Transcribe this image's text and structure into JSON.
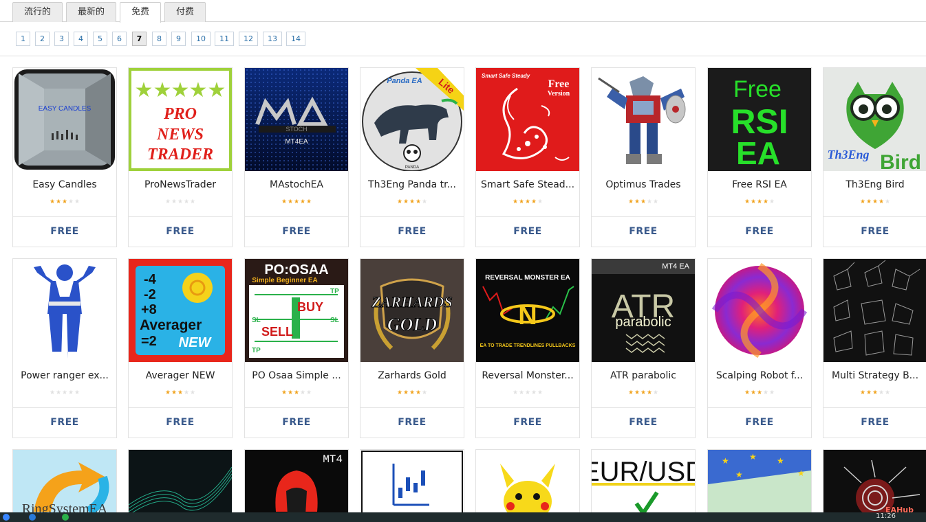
{
  "tabs": [
    "流行的",
    "最新的",
    "免费",
    "付费"
  ],
  "active_tab": 2,
  "pagination": {
    "pages": [
      "1",
      "2",
      "3",
      "4",
      "5",
      "6",
      "7",
      "8",
      "9",
      "10",
      "11",
      "12",
      "13",
      "14"
    ],
    "current": "7"
  },
  "products_row1": [
    {
      "title": "Easy Candles",
      "rating": 3,
      "price": "FREE",
      "thumb": "easy-candles"
    },
    {
      "title": "ProNewsTrader",
      "rating": 0,
      "price": "FREE",
      "thumb": "pro-news-trader"
    },
    {
      "title": "MAstochEA",
      "rating": 5,
      "price": "FREE",
      "thumb": "mastoch"
    },
    {
      "title": "Th3Eng Panda tr...",
      "rating": 4,
      "price": "FREE",
      "thumb": "panda"
    },
    {
      "title": "Smart Safe Stead...",
      "rating": 4,
      "price": "FREE",
      "thumb": "smart-safe"
    },
    {
      "title": "Optimus Trades",
      "rating": 3,
      "price": "FREE",
      "thumb": "optimus"
    },
    {
      "title": "Free RSI EA",
      "rating": 4,
      "price": "FREE",
      "thumb": "rsi"
    },
    {
      "title": "Th3Eng Bird",
      "rating": 4,
      "price": "FREE",
      "thumb": "bird"
    }
  ],
  "products_row2": [
    {
      "title": "Power ranger ex...",
      "rating": 0,
      "price": "FREE",
      "thumb": "ranger"
    },
    {
      "title": "Averager NEW",
      "rating": 3,
      "price": "FREE",
      "thumb": "averager"
    },
    {
      "title": "PO Osaa Simple ...",
      "rating": 3,
      "price": "FREE",
      "thumb": "poosaa"
    },
    {
      "title": "Zarhards Gold",
      "rating": 4,
      "price": "FREE",
      "thumb": "zarhards"
    },
    {
      "title": "Reversal Monster...",
      "rating": 0,
      "price": "FREE",
      "thumb": "reversal"
    },
    {
      "title": "ATR parabolic",
      "rating": 4,
      "price": "FREE",
      "thumb": "atr"
    },
    {
      "title": "Scalping Robot f...",
      "rating": 3,
      "price": "FREE",
      "thumb": "scalping"
    },
    {
      "title": "Multi Strategy B...",
      "rating": 3,
      "price": "FREE",
      "thumb": "multi"
    }
  ],
  "row3_labels": {
    "ring": "RingSystemEA",
    "mt4": "MT4",
    "eurusd": "EUR/USD"
  },
  "thumb_text": {
    "easy_candles": "EASY CANDLES",
    "pro_news": [
      "PRO",
      "NEWS",
      "TRADER"
    ],
    "mastoch_sub": "MT4EA",
    "panda_brand": "Panda EA",
    "lite": "Lite",
    "panda_small": "PANDA",
    "smart_safe_top": "Smart Safe Steady",
    "smart_safe_free": "Free",
    "smart_safe_version": "Version",
    "rsi": [
      "Free",
      "RSI",
      "EA"
    ],
    "bird": [
      "Th3Eng",
      "Bird"
    ],
    "averager": [
      "-4",
      "-2",
      "+8",
      "Averager",
      "=2",
      "NEW"
    ],
    "poosaa_title": "PO:OSAA",
    "poosaa_sub": "Simple Beginner EA",
    "poosaa_buy": "BUY",
    "poosaa_sell": "SELL",
    "tp": "TP",
    "sl": "SL",
    "zarhards": [
      "ZARHARDS",
      "GOLD"
    ],
    "reversal_title": "REVERSAL MONSTER EA",
    "reversal_arc": "EA TO TRADE TRENDLINES PULLBACKS",
    "atr": [
      "MT4 EA",
      "ATR",
      "parabolic"
    ]
  },
  "taskbar": {
    "time": "11:26",
    "badge": "EAHub"
  },
  "colors": {
    "price_text": "#3a5a8c",
    "star_on": "#f0a21c",
    "star_off": "#e0e0e0",
    "link": "#2a6fa8"
  }
}
